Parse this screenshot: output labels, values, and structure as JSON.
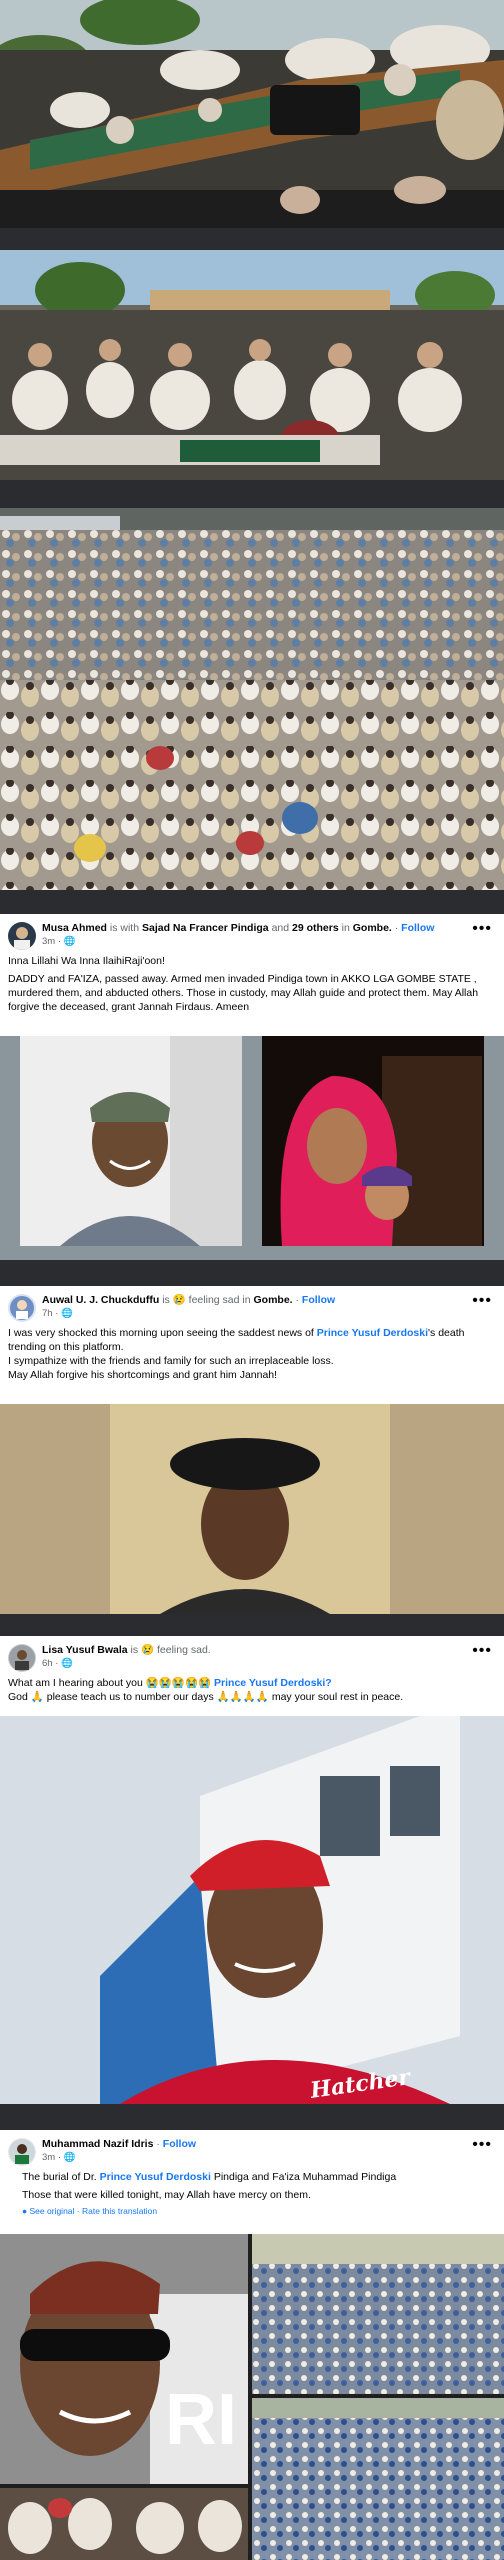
{
  "top_photos": [
    {
      "description_icon": "funeral-procession-photo"
    },
    {
      "description_icon": "crowd-photo"
    },
    {
      "description_icon": "mass-prayer-photo"
    }
  ],
  "post1": {
    "author": "Musa Ahmed",
    "is_with": "is with",
    "with_name": "Sajad Na Francer Pindiga",
    "and_text": "and",
    "others": "29 others",
    "in_text": "in",
    "place": "Gombe.",
    "follow": "Follow",
    "time": "3m",
    "line1": "Inna Lillahi Wa Inna IlaihiRaji'oon!",
    "line2": "DADDY and FA'IZA, passed away. Armed men invaded Pindiga town in AKKO LGA GOMBE STATE , murdered them, and abducted others. Those in custody, may Allah guide and protect them. May Allah forgive the deceased, grant Jannah Firdaus. Ameen"
  },
  "post2": {
    "author": "Auwal U. J. Chuckduffu",
    "feeling": "is 😢 feeling sad in",
    "place": "Gombe.",
    "follow": "Follow",
    "time": "7h",
    "text_a": "I was very shocked this morning upon seeing the saddest news of",
    "name_link": "Prince Yusuf Derdoski",
    "text_b": "'s death trending on this platform.",
    "line2": "I sympathize with the friends and family for such an irreplaceable loss.",
    "line3": "May Allah forgive his shortcomings and grant him Jannah!"
  },
  "post3": {
    "author": "Lisa Yusuf Bwala",
    "feeling": "is 😢 feeling sad.",
    "time": "6h",
    "text_a": "What am I hearing about you 😭😭😭😭😭",
    "name_link": "Prince Yusuf Derdoski?",
    "text_b": "God 🙏 please teach us to number our days 🙏🙏🙏🙏 may your soul rest in peace.",
    "shirt_text": "Hatcher"
  },
  "post4": {
    "author": "Muhammad Nazif Idris",
    "follow": "Follow",
    "time": "3m",
    "text_a": "The burial of Dr.",
    "name_link": "Prince Yusuf Derdoski",
    "text_b": "Pindiga and Fa'iza Muhammad Pindiga",
    "line2": "Those that were killed tonight, may Allah have mercy on them.",
    "see_original": "See original",
    "dot": "·",
    "rate": "Rate this translation",
    "overlay_text": "RI"
  },
  "colors": {
    "fb_blue": "#1877f2",
    "text": "#050505",
    "muted": "#65676b",
    "dark_bg": "#202124"
  }
}
